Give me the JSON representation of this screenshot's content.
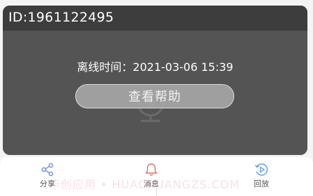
{
  "device": {
    "id_label": "ID:1961122495"
  },
  "status": {
    "offline_text": "离线时间：2021-03-06 15:39"
  },
  "help_button": {
    "label": "查看帮助"
  },
  "tabs": [
    {
      "label": "分享",
      "icon": "share-icon",
      "color": "#6b8fd6"
    },
    {
      "label": "消息",
      "icon": "bell-icon",
      "color": "#e0705a"
    },
    {
      "label": "回放",
      "icon": "playback-icon",
      "color": "#5a9be0"
    }
  ],
  "watermark": {
    "text": "华创应用 • HUACHUANGZS.COM"
  }
}
